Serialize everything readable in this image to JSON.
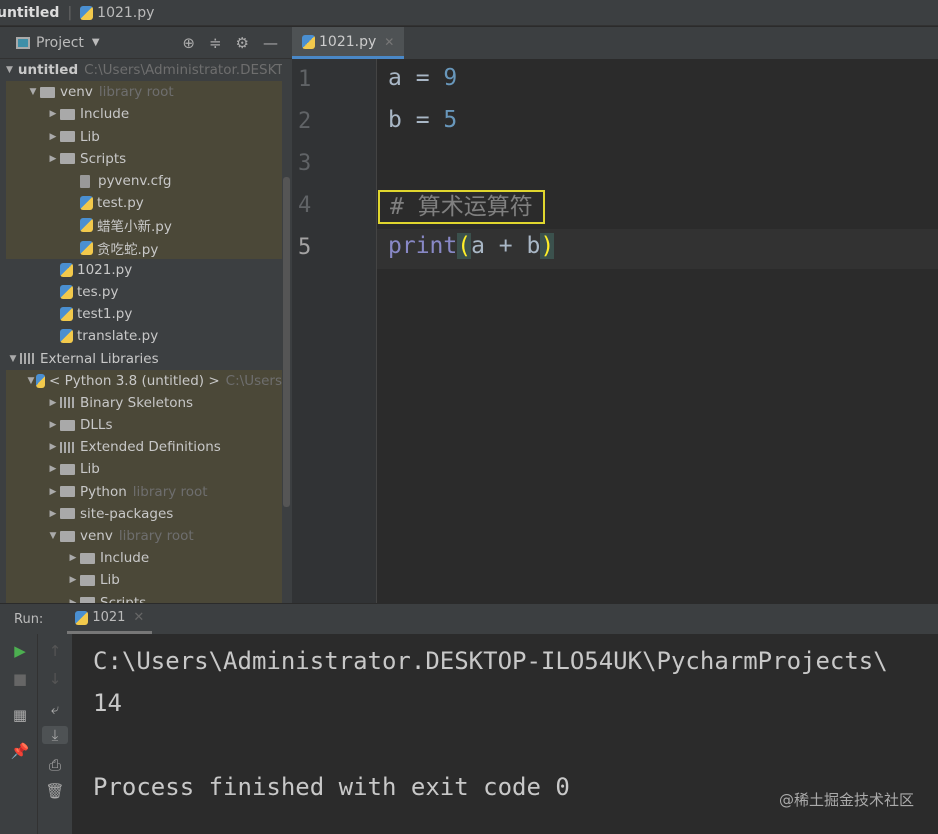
{
  "titlebar": {
    "project": "untitled",
    "file": "1021.py"
  },
  "sidebar": {
    "title": "Project",
    "tree": [
      {
        "label": "untitled",
        "hint": "C:\\Users\\Administrator.DESKTOP",
        "level": 0,
        "type": "folder",
        "open": true,
        "bold": true,
        "hl": false
      },
      {
        "label": "venv",
        "hint": "library root",
        "level": 1,
        "type": "folder",
        "open": true,
        "hl": true
      },
      {
        "label": "Include",
        "level": 2,
        "type": "folder",
        "open": false,
        "hl": true
      },
      {
        "label": "Lib",
        "level": 2,
        "type": "folder",
        "open": false,
        "hl": true
      },
      {
        "label": "Scripts",
        "level": 2,
        "type": "folder",
        "open": false,
        "hl": true
      },
      {
        "label": "pyvenv.cfg",
        "level": 3,
        "type": "file",
        "hl": true
      },
      {
        "label": "test.py",
        "level": 3,
        "type": "py",
        "hl": true
      },
      {
        "label": "蜡笔小新.py",
        "level": 3,
        "type": "py",
        "hl": true
      },
      {
        "label": "贪吃蛇.py",
        "level": 3,
        "type": "py",
        "hl": true
      },
      {
        "label": "1021.py",
        "level": 2,
        "type": "py",
        "hl": false
      },
      {
        "label": "tes.py",
        "level": 2,
        "type": "py",
        "hl": false
      },
      {
        "label": "test1.py",
        "level": 2,
        "type": "py",
        "hl": false
      },
      {
        "label": "translate.py",
        "level": 2,
        "type": "py",
        "hl": false
      },
      {
        "label": "External Libraries",
        "level": 0,
        "type": "lib",
        "open": true,
        "hl": false
      },
      {
        "label": "< Python 3.8 (untitled) >",
        "hint": "C:\\Users",
        "level": 1,
        "type": "py",
        "open": true,
        "hl": true
      },
      {
        "label": "Binary Skeletons",
        "level": 2,
        "type": "lib",
        "open": false,
        "hl": true
      },
      {
        "label": "DLLs",
        "level": 2,
        "type": "folder",
        "open": false,
        "hl": true
      },
      {
        "label": "Extended Definitions",
        "level": 2,
        "type": "lib",
        "open": false,
        "hl": true
      },
      {
        "label": "Lib",
        "level": 2,
        "type": "folder",
        "open": false,
        "hl": true
      },
      {
        "label": "Python",
        "hint": "library root",
        "level": 2,
        "type": "folder",
        "open": false,
        "hl": true
      },
      {
        "label": "site-packages",
        "level": 2,
        "type": "folder",
        "open": false,
        "hl": true
      },
      {
        "label": "venv",
        "hint": "library root",
        "level": 2,
        "type": "folder",
        "open": true,
        "hl": true
      },
      {
        "label": "Include",
        "level": 3,
        "type": "folder",
        "open": false,
        "hl": true
      },
      {
        "label": "Lib",
        "level": 3,
        "type": "folder",
        "open": false,
        "hl": true
      },
      {
        "label": "Scripts",
        "level": 3,
        "type": "folder",
        "open": false,
        "hl": true
      }
    ]
  },
  "editor": {
    "tab": "1021.py",
    "line_numbers": [
      "1",
      "2",
      "3",
      "4",
      "5"
    ],
    "line1": {
      "var": "a",
      "op": " = ",
      "num": "9"
    },
    "line2": {
      "var": "b",
      "op": " = ",
      "num": "5"
    },
    "line4": "# 算术运算符",
    "line5": {
      "fn": "print",
      "open": "(",
      "args": "a + b",
      "close": ")"
    }
  },
  "run": {
    "label": "Run:",
    "tab": "1021",
    "output": [
      "C:\\Users\\Administrator.DESKTOP-ILO54UK\\PycharmProjects\\",
      "14",
      "",
      "Process finished with exit code 0"
    ]
  },
  "watermark": "@稀土掘金技术社区"
}
